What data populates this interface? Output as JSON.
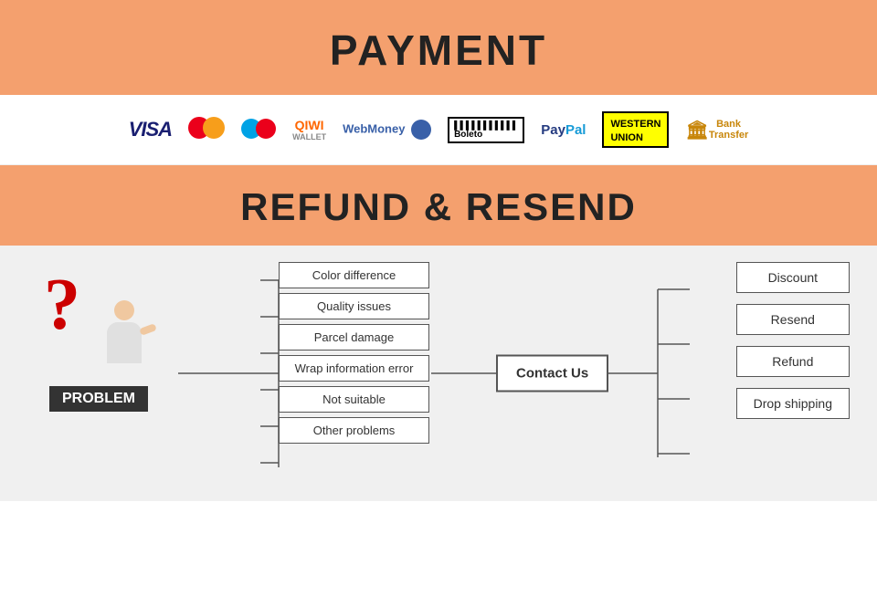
{
  "payment": {
    "title": "PAYMENT",
    "logos": [
      {
        "name": "Visa",
        "type": "visa"
      },
      {
        "name": "Mastercard",
        "type": "mastercard"
      },
      {
        "name": "Maestro",
        "type": "maestro"
      },
      {
        "name": "QIWI Wallet",
        "type": "qiwi"
      },
      {
        "name": "WebMoney",
        "type": "webmoney"
      },
      {
        "name": "Boleto",
        "type": "boleto"
      },
      {
        "name": "PayPal",
        "type": "paypal"
      },
      {
        "name": "Western Union",
        "type": "wu"
      },
      {
        "name": "Bank Transfer",
        "type": "bank"
      }
    ]
  },
  "refund": {
    "title": "REFUND & RESEND"
  },
  "diagram": {
    "problem_label": "PROBLEM",
    "problems": [
      "Color difference",
      "Quality issues",
      "Parcel damage",
      "Wrap information error",
      "Not suitable",
      "Other problems"
    ],
    "contact_us": "Contact Us",
    "outcomes": [
      "Discount",
      "Resend",
      "Refund",
      "Drop shipping"
    ]
  }
}
